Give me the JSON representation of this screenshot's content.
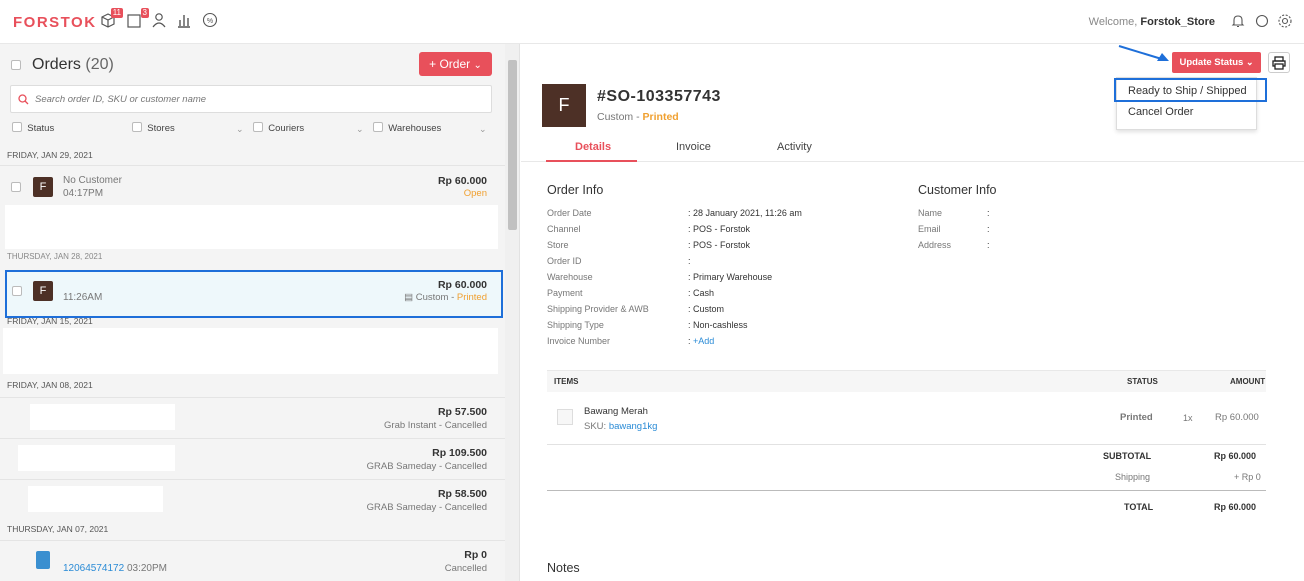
{
  "topbar": {
    "logo": "FORSTOK",
    "badges": {
      "orders": "11",
      "inventory": "3"
    },
    "welcome_prefix": "Welcome, ",
    "store_name": "Forstok_Store"
  },
  "left": {
    "orders_label": "Orders",
    "orders_count": "(20)",
    "order_button": "+ Order",
    "search_placeholder": "Search order ID, SKU or customer name",
    "filters": [
      "Status",
      "Stores",
      "Couriers",
      "Warehouses"
    ],
    "groups": [
      {
        "header": "FRIDAY, JAN 29, 2021",
        "rows": [
          {
            "avatar": "F",
            "name": "No Customer",
            "time": "04:17PM",
            "amount": "Rp 60.000",
            "status": "Open"
          }
        ]
      },
      {
        "header": "THURSDAY, JAN 28, 2021",
        "rows": [
          {
            "avatar": "F",
            "name": "",
            "time": "11:26AM",
            "amount": "Rp 60.000",
            "status_prefix": "Custom - ",
            "status": "Printed"
          }
        ]
      },
      {
        "header": "FRIDAY, JAN 15, 2021",
        "rows": []
      },
      {
        "header": "FRIDAY, JAN 08, 2021",
        "rows": [
          {
            "amount": "Rp 57.500",
            "status": "Grab Instant - Cancelled"
          },
          {
            "amount": "Rp 109.500",
            "status": "GRAB Sameday - Cancelled"
          },
          {
            "amount": "Rp 58.500",
            "status": "GRAB Sameday - Cancelled"
          }
        ]
      },
      {
        "header": "THURSDAY, JAN 07, 2021",
        "rows": [
          {
            "order_id": "12064574172",
            "time": "03:20PM",
            "amount": "Rp 0",
            "status": "Cancelled"
          }
        ]
      }
    ]
  },
  "right": {
    "update_status": "Update Status",
    "dropdown": [
      "Ready to Ship / Shipped",
      "Cancel Order"
    ],
    "avatar": "F",
    "order_number": "#SO-103357743",
    "channel_type": "Custom",
    "print_status": "Printed",
    "tabs": [
      "Details",
      "Invoice",
      "Activity"
    ],
    "order_info": {
      "title": "Order Info",
      "fields": [
        {
          "label": "Order Date",
          "value": ": 28 January 2021, 11:26 am"
        },
        {
          "label": "Channel",
          "value": ": POS - Forstok"
        },
        {
          "label": "Store",
          "value": ": POS - Forstok"
        },
        {
          "label": "Order ID",
          "value": ":"
        },
        {
          "label": "Warehouse",
          "value": ": Primary Warehouse"
        },
        {
          "label": "Payment",
          "value": ": Cash"
        },
        {
          "label": "Shipping Provider & AWB",
          "value": ": Custom"
        },
        {
          "label": "Shipping Type",
          "value": ": Non-cashless"
        },
        {
          "label": "Invoice Number",
          "value": ": ",
          "link": "+Add"
        }
      ]
    },
    "customer_info": {
      "title": "Customer Info",
      "fields": [
        {
          "label": "Name",
          "value": ":"
        },
        {
          "label": "Email",
          "value": ":"
        },
        {
          "label": "Address",
          "value": ":"
        }
      ]
    },
    "items_table": {
      "headers": {
        "items": "ITEMS",
        "status": "STATUS",
        "amount": "AMOUNT"
      },
      "rows": [
        {
          "name": "Bawang Merah",
          "sku_label": "SKU: ",
          "sku": "bawang1kg",
          "status": "Printed",
          "qty": "1x",
          "amount": "Rp 60.000"
        }
      ],
      "subtotal_label": "SUBTOTAL",
      "subtotal": "Rp 60.000",
      "shipping_label": "Shipping",
      "shipping": "+ Rp 0",
      "total_label": "TOTAL",
      "total": "Rp 60.000"
    },
    "notes_title": "Notes"
  },
  "colors": {
    "accent": "#e8505b",
    "highlight": "#1e6fd9",
    "printed": "#f0a030",
    "avatar": "#4d3026"
  }
}
